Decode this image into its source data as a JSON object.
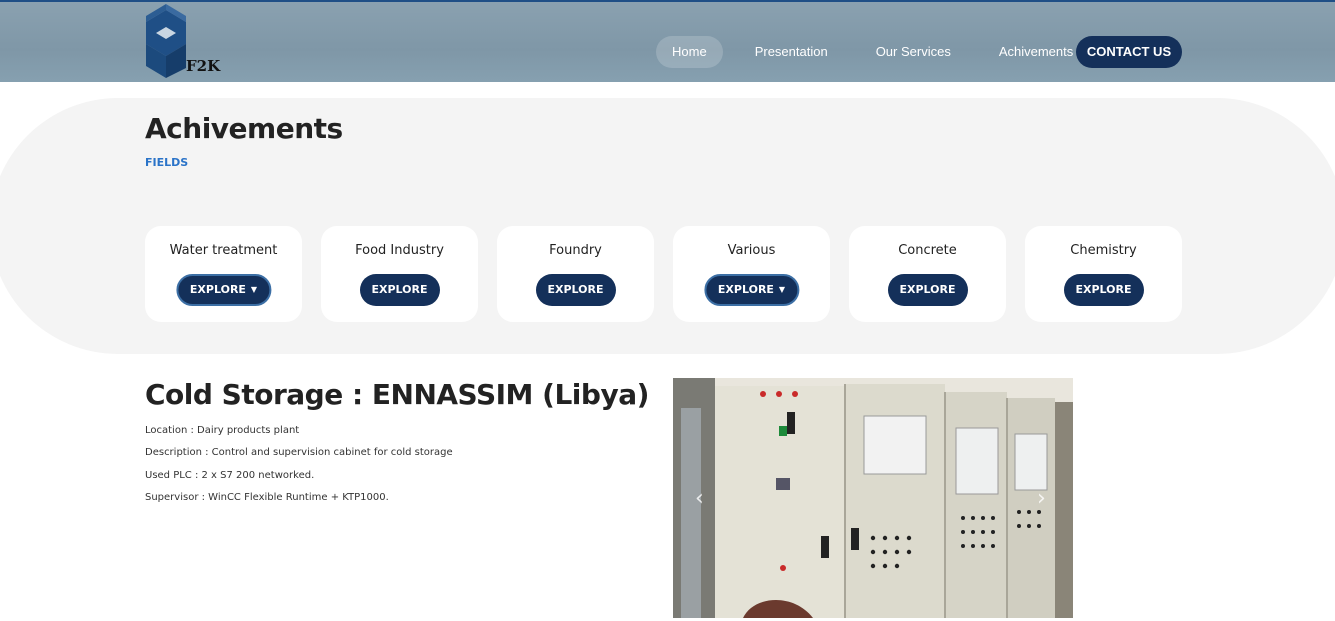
{
  "brand": {
    "logo_text": "F2K"
  },
  "nav": {
    "items": [
      "Home",
      "Presentation",
      "Our Services",
      "Achivements"
    ],
    "contact_label": "CONTACT US"
  },
  "colors": {
    "brand_dark": "#14305a",
    "accent_blue": "#2a73c8",
    "header_bg": "#86a0b0",
    "panel_bg": "#f4f4f4"
  },
  "section": {
    "title": "Achivements",
    "subtitle": "FIELDS"
  },
  "fields": [
    {
      "name": "Water treatment",
      "button": "EXPLORE",
      "dropdown": true
    },
    {
      "name": "Food Industry",
      "button": "EXPLORE",
      "dropdown": false
    },
    {
      "name": "Foundry",
      "button": "EXPLORE",
      "dropdown": false
    },
    {
      "name": "Various",
      "button": "EXPLORE",
      "dropdown": true
    },
    {
      "name": "Concrete",
      "button": "EXPLORE",
      "dropdown": false
    },
    {
      "name": "Chemistry",
      "button": "EXPLORE",
      "dropdown": false
    }
  ],
  "project": {
    "title": "Cold Storage : ENNASSIM (Libya)",
    "location": "Location : Dairy products plant",
    "description": "Description : Control and supervision cabinet for cold storage",
    "plc": "Used PLC : 2 x S7 200 networked.",
    "supervisor": "Supervisor : WinCC Flexible Runtime + KTP1000."
  },
  "carousel": {
    "prev_icon": "chevron-left-icon",
    "next_icon": "chevron-right-icon"
  }
}
